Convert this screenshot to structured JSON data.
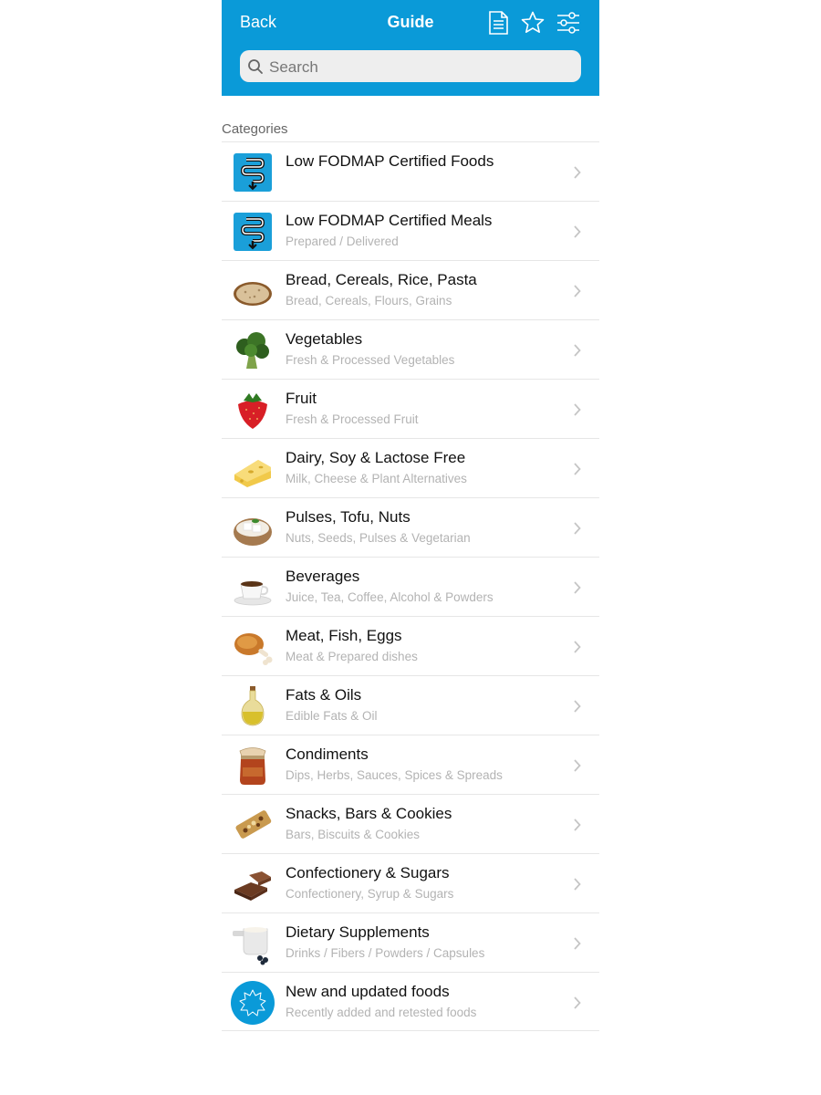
{
  "header": {
    "back_label": "Back",
    "title": "Guide",
    "icons": [
      "document-icon",
      "star-icon",
      "sliders-icon"
    ],
    "accent_color": "#0a9ad8"
  },
  "search": {
    "placeholder": "Search"
  },
  "section_title": "Categories",
  "categories": [
    {
      "title": "Low FODMAP Certified Foods",
      "subtitle": "",
      "icon": "certified-logo-icon"
    },
    {
      "title": "Low FODMAP Certified Meals",
      "subtitle": "Prepared / Delivered",
      "icon": "certified-logo-icon"
    },
    {
      "title": "Bread, Cereals, Rice, Pasta",
      "subtitle": "Bread, Cereals, Flours, Grains",
      "icon": "bread-icon"
    },
    {
      "title": "Vegetables",
      "subtitle": "Fresh & Processed Vegetables",
      "icon": "broccoli-icon"
    },
    {
      "title": "Fruit",
      "subtitle": "Fresh & Processed Fruit",
      "icon": "strawberry-icon"
    },
    {
      "title": "Dairy, Soy & Lactose Free",
      "subtitle": "Milk, Cheese & Plant Alternatives",
      "icon": "cheese-icon"
    },
    {
      "title": "Pulses, Tofu, Nuts",
      "subtitle": "Nuts, Seeds, Pulses & Vegetarian",
      "icon": "tofu-bowl-icon"
    },
    {
      "title": "Beverages",
      "subtitle": "Juice, Tea, Coffee, Alcohol & Powders",
      "icon": "coffee-cup-icon"
    },
    {
      "title": "Meat, Fish, Eggs",
      "subtitle": "Meat & Prepared dishes",
      "icon": "chicken-leg-icon"
    },
    {
      "title": "Fats & Oils",
      "subtitle": "Edible Fats & Oil",
      "icon": "oil-bottle-icon"
    },
    {
      "title": "Condiments",
      "subtitle": "Dips, Herbs, Sauces, Spices & Spreads",
      "icon": "jam-jar-icon"
    },
    {
      "title": "Snacks, Bars & Cookies",
      "subtitle": "Bars, Biscuits & Cookies",
      "icon": "snack-bar-icon"
    },
    {
      "title": "Confectionery & Sugars",
      "subtitle": "Confectionery, Syrup & Sugars",
      "icon": "chocolate-icon"
    },
    {
      "title": "Dietary Supplements",
      "subtitle": "Drinks / Fibers / Powders / Capsules",
      "icon": "supplement-scoop-icon"
    },
    {
      "title": "New and updated foods",
      "subtitle": "Recently added and retested foods",
      "icon": "new-badge-icon"
    }
  ]
}
